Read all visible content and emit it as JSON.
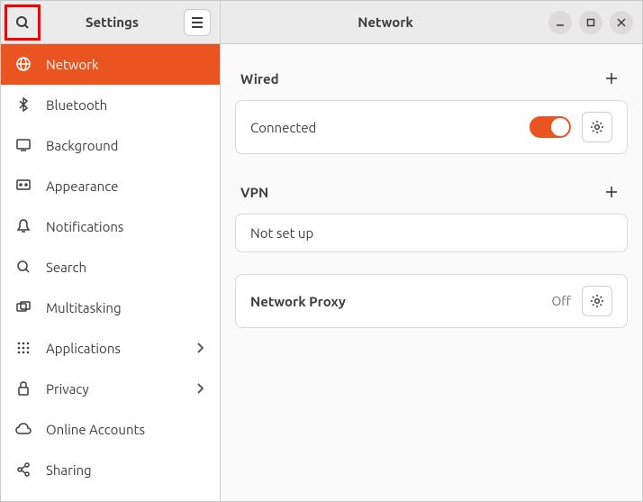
{
  "sidebar": {
    "title": "Settings",
    "items": [
      {
        "key": "network",
        "label": "Network",
        "active": true,
        "has_sub": false
      },
      {
        "key": "bluetooth",
        "label": "Bluetooth",
        "active": false,
        "has_sub": false
      },
      {
        "key": "background",
        "label": "Background",
        "active": false,
        "has_sub": false
      },
      {
        "key": "appearance",
        "label": "Appearance",
        "active": false,
        "has_sub": false
      },
      {
        "key": "notifications",
        "label": "Notifications",
        "active": false,
        "has_sub": false
      },
      {
        "key": "search",
        "label": "Search",
        "active": false,
        "has_sub": false
      },
      {
        "key": "multitasking",
        "label": "Multitasking",
        "active": false,
        "has_sub": false
      },
      {
        "key": "applications",
        "label": "Applications",
        "active": false,
        "has_sub": true
      },
      {
        "key": "privacy",
        "label": "Privacy",
        "active": false,
        "has_sub": true
      },
      {
        "key": "online-accounts",
        "label": "Online Accounts",
        "active": false,
        "has_sub": false
      },
      {
        "key": "sharing",
        "label": "Sharing",
        "active": false,
        "has_sub": false
      }
    ]
  },
  "main": {
    "title": "Network",
    "sections": {
      "wired": {
        "heading": "Wired",
        "status": "Connected",
        "toggle_on": true
      },
      "vpn": {
        "heading": "VPN",
        "status": "Not set up"
      },
      "proxy": {
        "label": "Network Proxy",
        "status": "Off"
      }
    }
  },
  "colors": {
    "accent": "#e95420"
  }
}
